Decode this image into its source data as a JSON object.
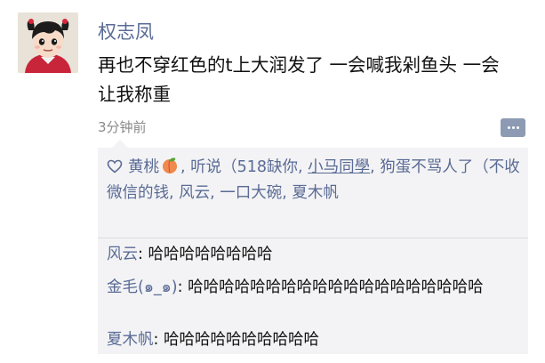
{
  "post": {
    "author": "权志凤",
    "text": "再也不穿红色的t上大润发了 一会喊我剁鱼头 一会让我称重",
    "time": "3分钟前"
  },
  "likes": {
    "names": [
      {
        "text": "黄桃",
        "icon": "peach-emoji"
      },
      {
        "text": ", 听说（518缺你, "
      },
      {
        "text": "小马同學",
        "underline": true
      },
      {
        "text": ", 狗蛋不骂人了（不收微信的钱, 风云, 一口大碗, 夏木帆"
      }
    ]
  },
  "comments": [
    {
      "name": "风云",
      "separator": ": ",
      "text": "哈哈哈哈哈哈哈哈"
    },
    {
      "name": "金毛(๑_๑)",
      "separator": ": ",
      "text": "哈哈哈哈哈哈哈哈哈哈哈哈哈哈哈哈哈哈哈"
    },
    {
      "name": "夏木帆",
      "separator": ": ",
      "text": "哈哈哈哈哈哈哈哈哈哈"
    }
  ],
  "colors": {
    "name_blue": "#5a6b95",
    "panel_bg": "#f3f3f5",
    "time_gray": "#8a8a8a"
  }
}
